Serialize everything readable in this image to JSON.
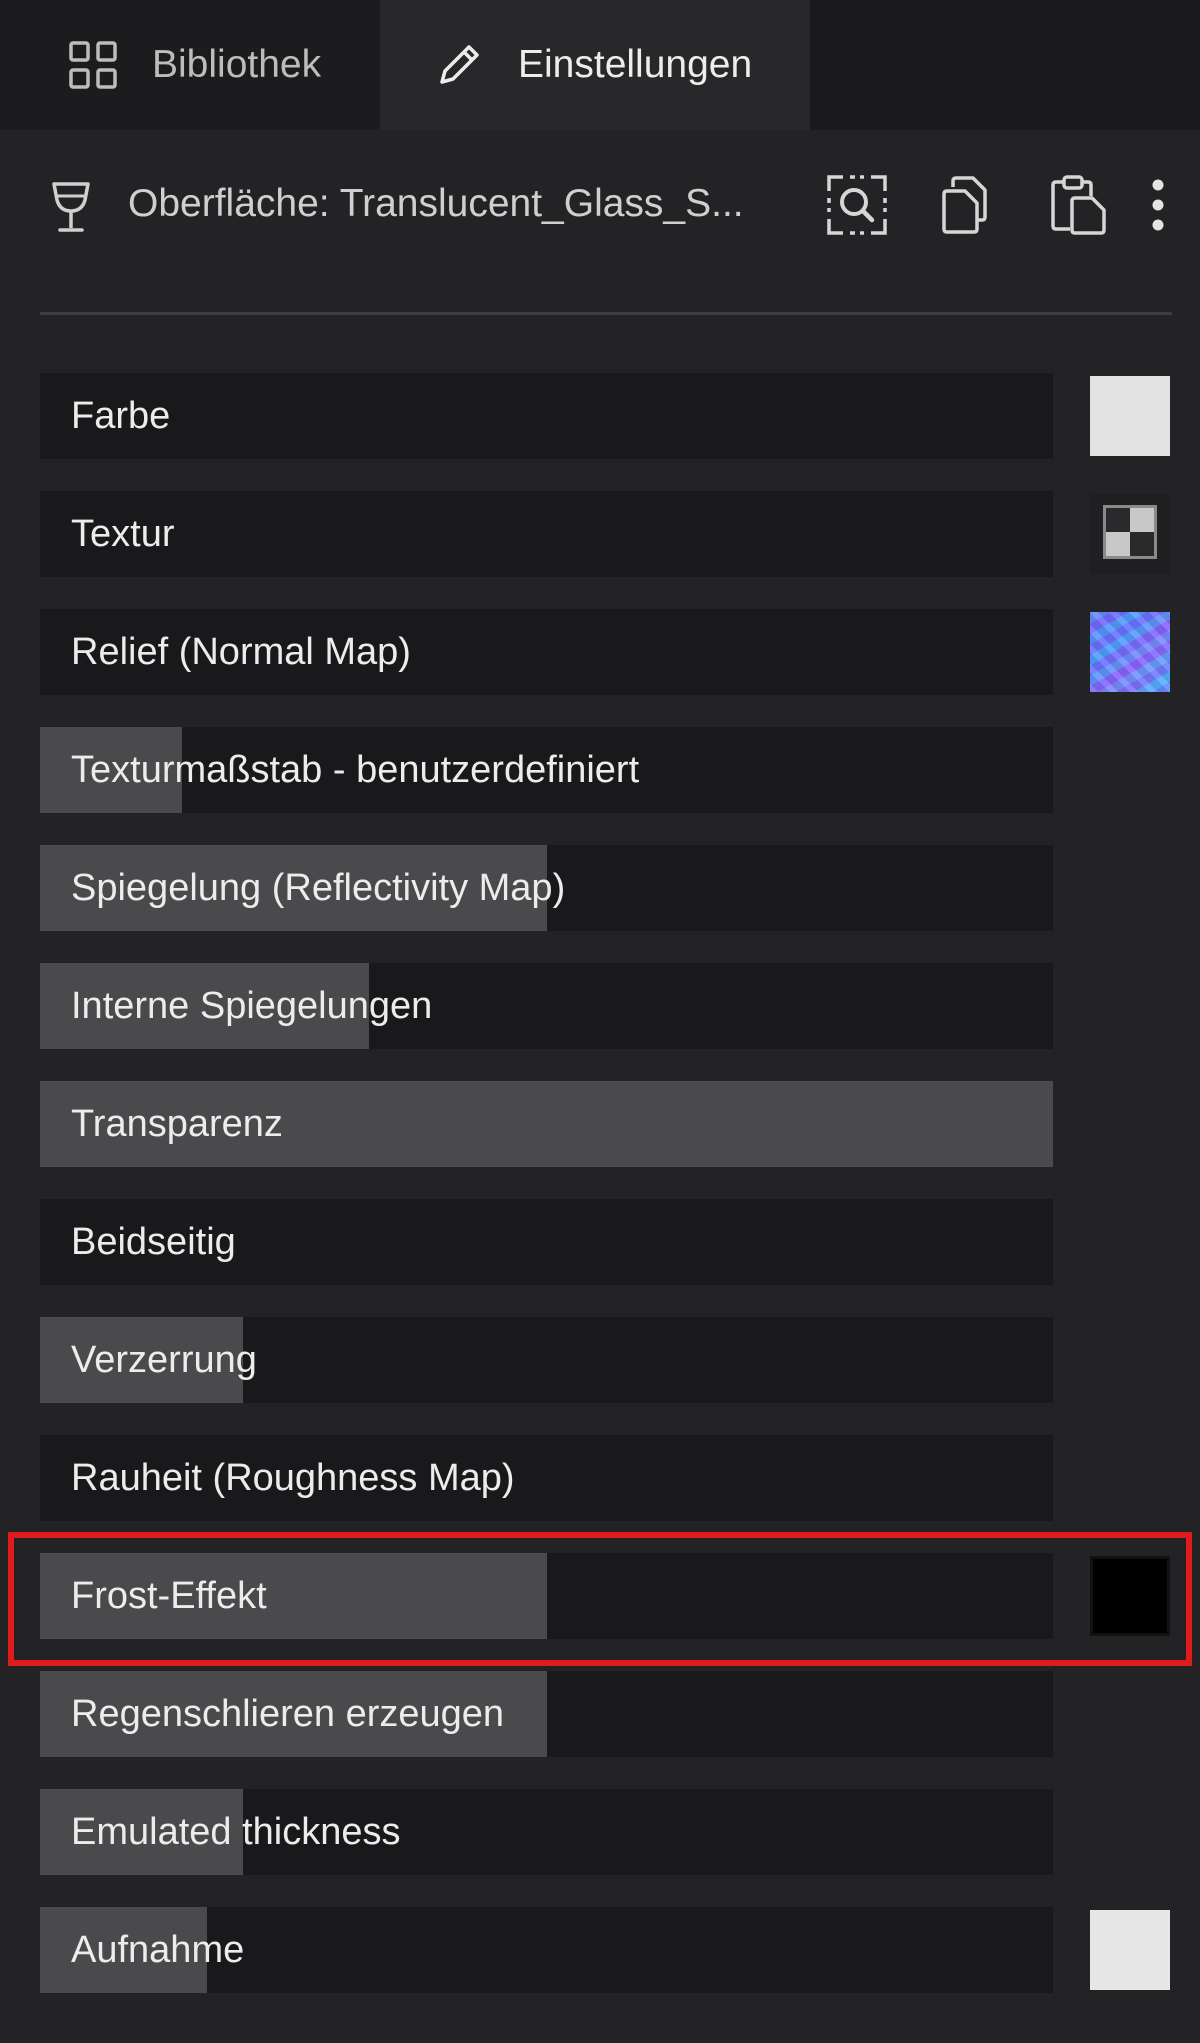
{
  "tabs": [
    {
      "label": "Bibliothek",
      "icon": "grid-icon",
      "active": false
    },
    {
      "label": "Einstellungen",
      "icon": "pencil-icon",
      "active": true
    }
  ],
  "header": {
    "material_icon": "wineglass-icon",
    "title": "Oberfläche: Translucent_Glass_S...",
    "actions": [
      "find-material-icon",
      "copy-icon",
      "paste-icon",
      "more-vertical-icon"
    ]
  },
  "properties": [
    {
      "label": "Farbe",
      "fill_percent": 0,
      "swatch": "color",
      "swatch_color": "#e3e3e3"
    },
    {
      "label": "Textur",
      "fill_percent": 0,
      "swatch": "texture-icon"
    },
    {
      "label": "Relief (Normal Map)",
      "fill_percent": 0,
      "swatch": "normal-map-thumbnail"
    },
    {
      "label": "Texturmaßstab - benutzerdefiniert",
      "fill_percent": 14
    },
    {
      "label": "Spiegelung (Reflectivity Map)",
      "fill_percent": 50
    },
    {
      "label": "Interne Spiegelungen",
      "fill_percent": 32.5
    },
    {
      "label": "Transparenz",
      "fill_percent": 100
    },
    {
      "label": "Beidseitig",
      "fill_percent": 0
    },
    {
      "label": "Verzerrung",
      "fill_percent": 20
    },
    {
      "label": "Rauheit (Roughness Map)",
      "fill_percent": 0
    },
    {
      "label": "Frost-Effekt",
      "fill_percent": 50,
      "swatch": "color",
      "swatch_color": "#000000",
      "highlighted": true
    },
    {
      "label": "Regenschlieren erzeugen",
      "fill_percent": 50
    },
    {
      "label": "Emulated thickness",
      "fill_percent": 20
    },
    {
      "label": "Aufnahme",
      "fill_percent": 16.5,
      "swatch": "color",
      "swatch_color": "#e6e6e6"
    }
  ],
  "colors": {
    "panel_bg": "#232326",
    "row_bg": "#19191b",
    "fill": "#4a4a4d",
    "highlight": "#e01b1b"
  }
}
